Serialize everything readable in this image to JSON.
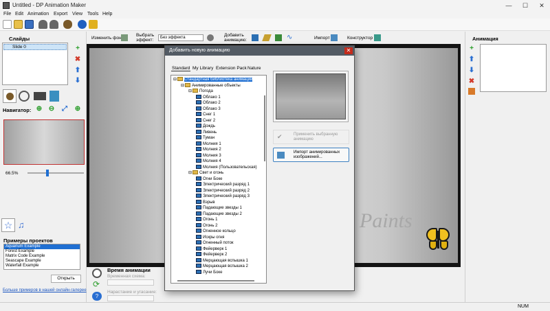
{
  "window": {
    "title": "Untitled - DP Animation Maker",
    "minimize": "—",
    "maximize": "☐",
    "close": "✕"
  },
  "menu": [
    "File",
    "Edit",
    "Animation",
    "Export",
    "View",
    "Tools",
    "Help"
  ],
  "slides": {
    "title": "Слайды",
    "items": [
      "Slide 0"
    ]
  },
  "navigator": {
    "title": "Навигатор:",
    "zoom": "66.5%",
    "zoom_fraction": 0.35
  },
  "examples": {
    "title": "Примеры проектов",
    "items": [
      "Aquarium Example",
      "Forest Example",
      "Matrix Code Example",
      "Seascape Example",
      "Waterfall Example"
    ],
    "open_button": "Открыть",
    "gallery_link": "Больше примеров в нашей онлайн-галерее"
  },
  "effects_bar": {
    "change_bg": "Изменить фон",
    "choose_effect": "Выбрать эффект:",
    "effect_value": "Без эффекта",
    "add_animation": "Добавить анимацию:",
    "import": "Импорт",
    "constructor": "Конструктор"
  },
  "bottom": {
    "time_title": "Время анимации",
    "time_scheme": "Временная схема:",
    "rise": "Нарастание и угасание:"
  },
  "right_panel": {
    "title": "Анимация"
  },
  "status": {
    "num": "NUM"
  },
  "canvas": {
    "watermark": "Paints"
  },
  "dialog": {
    "title": "Добавить новую анимацию",
    "tabs": [
      "Standard",
      "My Library",
      "Extension Pack",
      "Nature"
    ],
    "tree": [
      {
        "level": 0,
        "type": "folder",
        "label": "Стандартная библиотека анимаций",
        "selected": true
      },
      {
        "level": 1,
        "type": "folder",
        "label": "Анимированные объекты"
      },
      {
        "level": 2,
        "type": "folder",
        "label": "Погода"
      },
      {
        "level": 3,
        "type": "item",
        "label": "Облако 1"
      },
      {
        "level": 3,
        "type": "item",
        "label": "Облако 2"
      },
      {
        "level": 3,
        "type": "item",
        "label": "Облако 3"
      },
      {
        "level": 3,
        "type": "item",
        "label": "Снег 1"
      },
      {
        "level": 3,
        "type": "item",
        "label": "Снег 2"
      },
      {
        "level": 3,
        "type": "item",
        "label": "Дождь"
      },
      {
        "level": 3,
        "type": "item",
        "label": "Ливень"
      },
      {
        "level": 3,
        "type": "item",
        "label": "Туман"
      },
      {
        "level": 3,
        "type": "item",
        "label": "Молния 1"
      },
      {
        "level": 3,
        "type": "item",
        "label": "Молния 2"
      },
      {
        "level": 3,
        "type": "item",
        "label": "Молния 3"
      },
      {
        "level": 3,
        "type": "item",
        "label": "Молния 4"
      },
      {
        "level": 3,
        "type": "item",
        "label": "Молния (Пользовательская)"
      },
      {
        "level": 2,
        "type": "folder",
        "label": "Свет и огонь"
      },
      {
        "level": 3,
        "type": "item",
        "label": "Огни Боке"
      },
      {
        "level": 3,
        "type": "item",
        "label": "Электрический разряд 1"
      },
      {
        "level": 3,
        "type": "item",
        "label": "Электрический разряд 2"
      },
      {
        "level": 3,
        "type": "item",
        "label": "Электрический разряд 3"
      },
      {
        "level": 3,
        "type": "item",
        "label": "Взрыв"
      },
      {
        "level": 3,
        "type": "item",
        "label": "Падающие звезды 1"
      },
      {
        "level": 3,
        "type": "item",
        "label": "Падающие звезды 2"
      },
      {
        "level": 3,
        "type": "item",
        "label": "Огонь 1"
      },
      {
        "level": 3,
        "type": "item",
        "label": "Огонь 2"
      },
      {
        "level": 3,
        "type": "item",
        "label": "Огненное кольцо"
      },
      {
        "level": 3,
        "type": "item",
        "label": "Искры огня"
      },
      {
        "level": 3,
        "type": "item",
        "label": "Огненный поток"
      },
      {
        "level": 3,
        "type": "item",
        "label": "Фейерверк 1"
      },
      {
        "level": 3,
        "type": "item",
        "label": "Фейерверк 2"
      },
      {
        "level": 3,
        "type": "item",
        "label": "Мерцающая вспышка 1"
      },
      {
        "level": 3,
        "type": "item",
        "label": "Мерцающая вспышка 2"
      },
      {
        "level": 3,
        "type": "item",
        "label": "Лучи Боке"
      }
    ],
    "apply_button": "Применить выбранную анимацию",
    "import_button": "Импорт анимированных изображений..."
  }
}
